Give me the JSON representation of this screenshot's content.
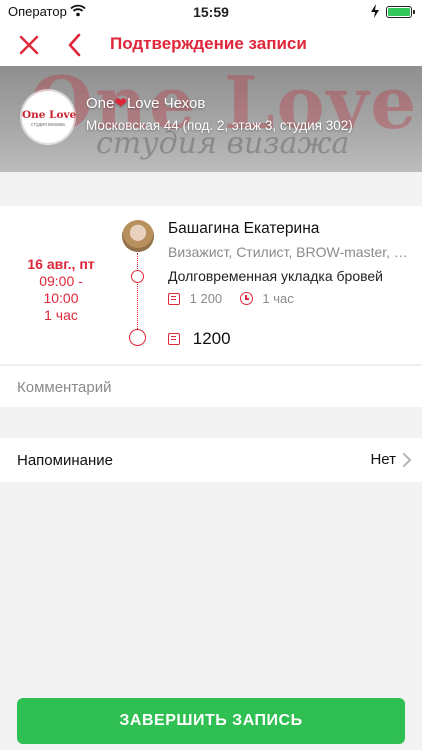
{
  "status_bar": {
    "carrier": "Оператор",
    "time": "15:59"
  },
  "nav": {
    "title": "Подтверждение записи"
  },
  "salon": {
    "name_before": "One",
    "name_after": "Love Чехов",
    "address": "Московская 44 (под. 2, этаж 3, студия 302)",
    "banner_text_big": "One Love",
    "banner_text_small": "студия визажа",
    "logo_text": "One Love",
    "logo_subtext": "студия визажа"
  },
  "booking": {
    "date": "16 авг., пт",
    "time_start": "09:00 -",
    "time_end": "10:00",
    "duration": "1 час",
    "master_name": "Башагина Екатерина",
    "master_role": "Визажист, Стилист, BROW-master, Мастер",
    "service_name": "Долговременная укладка бровей",
    "service_price": "1 200",
    "service_duration": "1 час",
    "total": "1200"
  },
  "comment": {
    "placeholder": "Комментарий"
  },
  "reminder": {
    "label": "Напоминание",
    "value": "Нет"
  },
  "actions": {
    "finish_label": "ЗАВЕРШИТЬ ЗАПИСЬ"
  },
  "colors": {
    "accent": "#e0263a",
    "button": "#2fbf52"
  }
}
